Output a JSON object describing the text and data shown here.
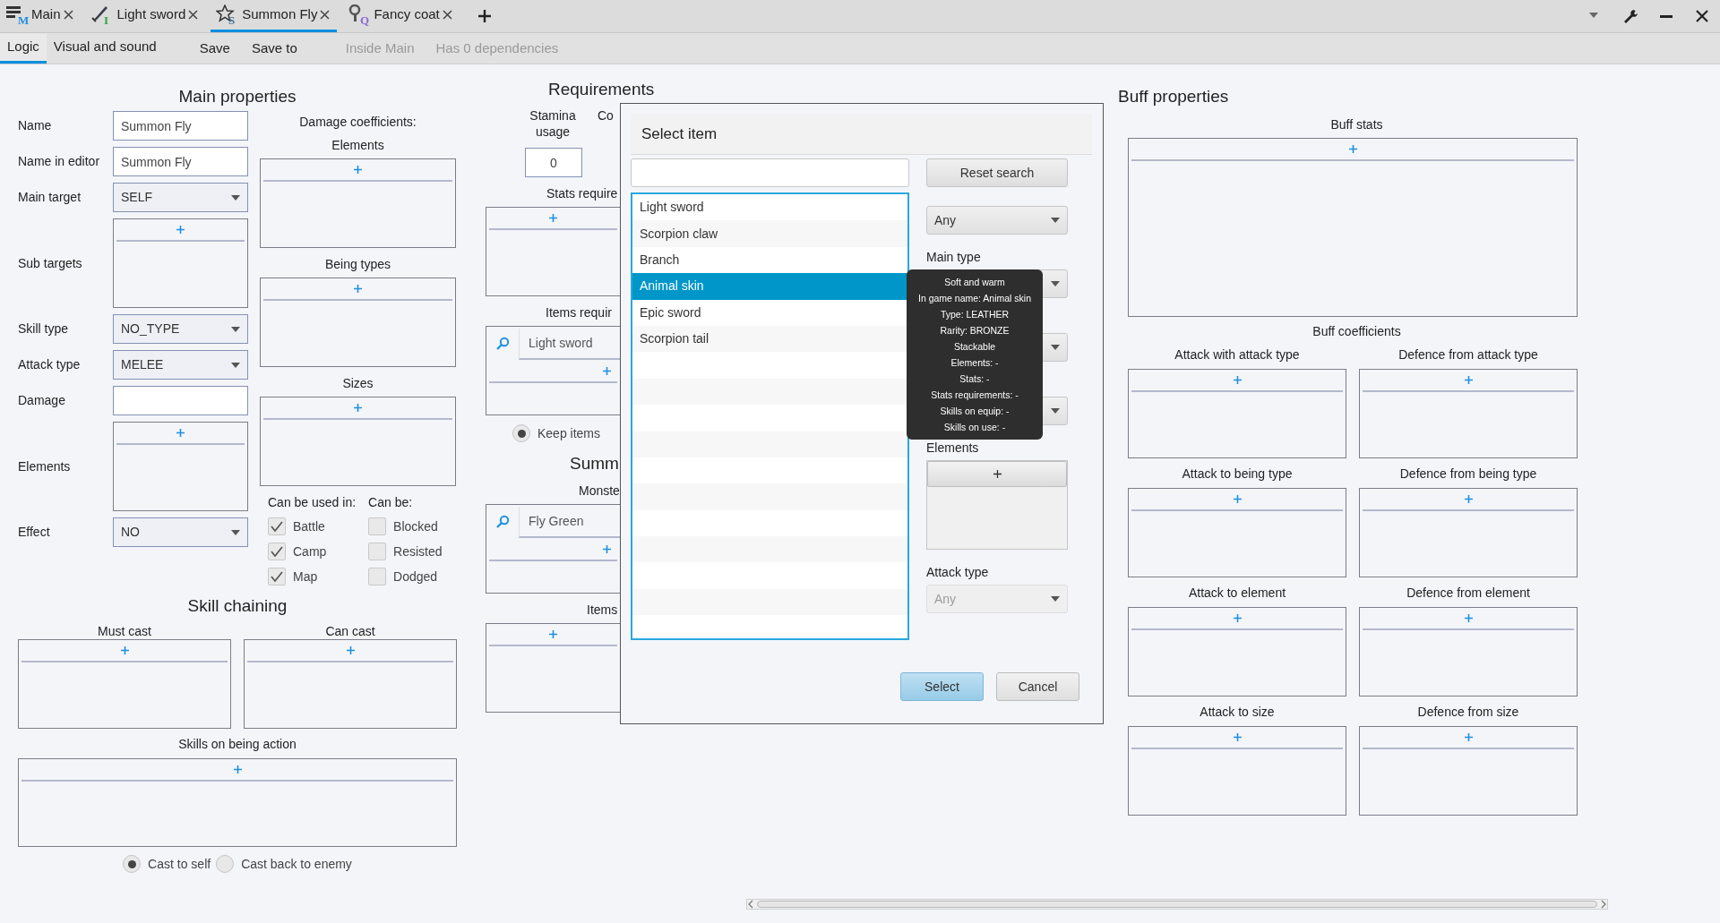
{
  "tabs": [
    {
      "label": "Main",
      "icon_letter": "M",
      "selected": false
    },
    {
      "label": "Light sword",
      "icon_letter": "I",
      "selected": false
    },
    {
      "label": "Summon Fly",
      "icon_letter": "S",
      "selected": true
    },
    {
      "label": "Fancy coat",
      "icon_letter": "Q",
      "selected": false
    }
  ],
  "subtabs": [
    {
      "label": "Logic",
      "selected": true
    },
    {
      "label": "Visual and sound",
      "selected": false
    }
  ],
  "toolbar": [
    {
      "label": "Save",
      "disabled": false
    },
    {
      "label": "Save to",
      "disabled": false
    },
    {
      "label": "Inside Main",
      "disabled": true
    },
    {
      "label": "Has 0 dependencies",
      "disabled": true
    }
  ],
  "main_properties": {
    "title": "Main properties",
    "fields": [
      {
        "kind": "text",
        "label": "Name",
        "value": "Summon Fly"
      },
      {
        "kind": "text",
        "label": "Name in editor",
        "value": "Summon Fly"
      },
      {
        "kind": "select",
        "label": "Main target",
        "value": "SELF"
      },
      {
        "kind": "list",
        "label": "Sub targets"
      },
      {
        "kind": "select",
        "label": "Skill type",
        "value": "NO_TYPE"
      },
      {
        "kind": "select",
        "label": "Attack type",
        "value": "MELEE"
      },
      {
        "kind": "text",
        "label": "Damage"
      },
      {
        "kind": "list",
        "label": "Elements"
      },
      {
        "kind": "select",
        "label": "Effect",
        "value": "NO"
      }
    ],
    "damage_coefficients": {
      "title": "Damage coefficients:",
      "lists": [
        "Elements",
        "Being types",
        "Sizes"
      ]
    },
    "option_groups": [
      {
        "title": "Can be used in:",
        "options": [
          {
            "label": "Battle",
            "checked": true
          },
          {
            "label": "Camp",
            "checked": true
          },
          {
            "label": "Map",
            "checked": true
          }
        ]
      },
      {
        "title": "Can be:",
        "options": [
          {
            "label": "Blocked",
            "checked": false
          },
          {
            "label": "Resisted",
            "checked": false
          },
          {
            "label": "Dodged",
            "checked": false
          }
        ]
      }
    ]
  },
  "skill_chaining": {
    "title": "Skill chaining",
    "lists": [
      "Must cast",
      "Can cast"
    ],
    "wide_list": "Skills on being action",
    "radios": [
      {
        "label": "Cast to self",
        "selected": true
      },
      {
        "label": "Cast back to enemy",
        "selected": false
      }
    ]
  },
  "requirements": {
    "title": "Requirements",
    "stamina_label": "Stamina usage",
    "column_2_label": "Co",
    "stamina_value": "0",
    "sections": [
      {
        "kind": "list",
        "label": "Stats require"
      },
      {
        "kind": "search_list",
        "label": "Items requir",
        "entries": [
          "Light sword"
        ]
      },
      {
        "kind": "radio",
        "label": "Keep items",
        "selected": true
      },
      {
        "kind": "heading",
        "label": "Summ"
      },
      {
        "kind": "search_list",
        "label": "Monste",
        "entries": [
          "Fly Green"
        ]
      },
      {
        "kind": "list",
        "label": "Items"
      }
    ]
  },
  "buff_properties": {
    "title": "Buff properties",
    "stats_label": "Buff stats",
    "coefficients_label": "Buff coefficients",
    "lists": [
      "Attack with attack type",
      "Defence from attack type",
      "Attack to being type",
      "Defence from being type",
      "Attack to element",
      "Defence from element",
      "Attack to size",
      "Defence from size"
    ]
  },
  "dialog": {
    "title": "Select item",
    "reset_button": "Reset search",
    "items": [
      {
        "label": "Light sword",
        "selected": false
      },
      {
        "label": "Scorpion claw",
        "selected": false
      },
      {
        "label": "Branch",
        "selected": false
      },
      {
        "label": "Animal skin",
        "selected": true
      },
      {
        "label": "Epic sword",
        "selected": false
      },
      {
        "label": "Scorpion tail",
        "selected": false
      }
    ],
    "filters": [
      {
        "kind": "select",
        "value": "Any",
        "disabled": false
      },
      {
        "kind": "select",
        "label": "Main type",
        "disabled": false
      },
      {
        "kind": "select",
        "disabled": false
      },
      {
        "kind": "select",
        "disabled": false
      },
      {
        "kind": "list",
        "label": "Elements"
      },
      {
        "kind": "select",
        "label": "Attack type",
        "value": "Any",
        "disabled": true
      }
    ],
    "buttons": [
      {
        "label": "Select",
        "primary": true
      },
      {
        "label": "Cancel",
        "primary": false
      }
    ]
  },
  "tooltip": {
    "lines": [
      "Soft and warm",
      "In game name: Animal skin",
      "Type: LEATHER",
      "Rarity: BRONZE",
      "Stackable",
      "Elements: -",
      "Stats: -",
      "Stats requirements: -",
      "Skills on equip: -",
      "Skills on use: -"
    ]
  }
}
